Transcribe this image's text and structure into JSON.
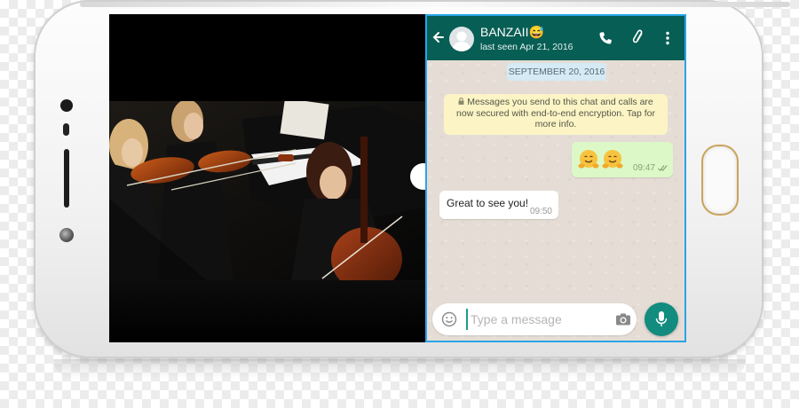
{
  "chat": {
    "contact_name": "BANZAII😅",
    "last_seen": "last seen Apr 21, 2016",
    "date_divider": "SEPTEMBER 20, 2016",
    "encryption_notice": "Messages you send to this chat and calls are now secured with end-to-end encryption. Tap for more info.",
    "messages": [
      {
        "direction": "outgoing",
        "content": "hugging-face-emoji x2",
        "time": "09:47",
        "status": "read-double-check"
      },
      {
        "direction": "incoming",
        "text": "Great to see you!",
        "time": "09:50"
      }
    ],
    "compose_placeholder": "Type a message"
  },
  "colors": {
    "header": "#075e54",
    "outgoing_bubble": "#dcf8c6",
    "accent": "#128c7e",
    "selection_border": "#2aa4e6"
  },
  "icons": [
    "back-arrow-icon",
    "phone-icon",
    "paperclip-icon",
    "more-vert-icon",
    "lock-icon",
    "smiley-icon",
    "camera-icon",
    "mic-icon",
    "double-check-icon"
  ]
}
